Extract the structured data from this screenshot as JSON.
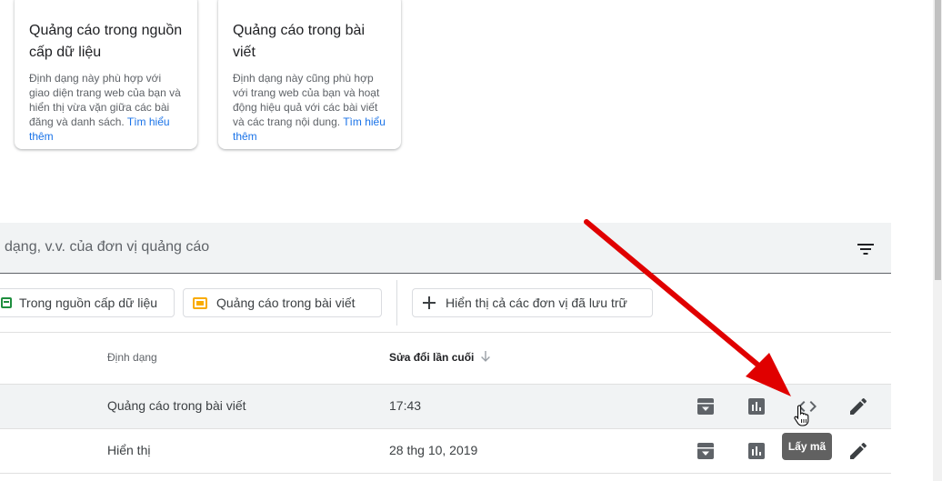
{
  "cards": [
    {
      "title": "Quảng cáo trong nguồn cấp dữ liệu",
      "description": "Định dạng này phù hợp với giao diện trang web của bạn và hiển thị vừa vặn giữa các bài đăng và danh sách.",
      "link": "Tìm hiểu thêm"
    },
    {
      "title": "Quảng cáo trong bài viết",
      "description": "Định dạng này cũng phù hợp với trang web của bạn và hoạt động hiệu quả với các bài viết và các trang nội dung.",
      "link": "Tìm hiểu thêm"
    }
  ],
  "search": {
    "placeholder_text": "dạng, v.v. của đơn vị quảng cáo",
    "filter_icon": "filter-list-icon"
  },
  "chips": [
    {
      "label": "Trong nguồn cấp dữ liệu",
      "color": "#1e8e3e"
    },
    {
      "label": "Quảng cáo trong bài viết",
      "color": "#f9ab00"
    },
    {
      "label": "Hiển thị cả các đơn vị đã lưu trữ",
      "icon": "plus-icon"
    }
  ],
  "table": {
    "headers": {
      "format": "Định dạng",
      "modified": "Sửa đổi lần cuối"
    },
    "rows": [
      {
        "format": "Quảng cáo trong bài viết",
        "modified": "17:43"
      },
      {
        "format": "Hiển thị",
        "modified": "28 thg 10, 2019"
      }
    ]
  },
  "tooltip": "Lấy mã",
  "colors": {
    "accent": "#1a73e8",
    "arrow": "#e00000",
    "icon": "#5f6368"
  }
}
